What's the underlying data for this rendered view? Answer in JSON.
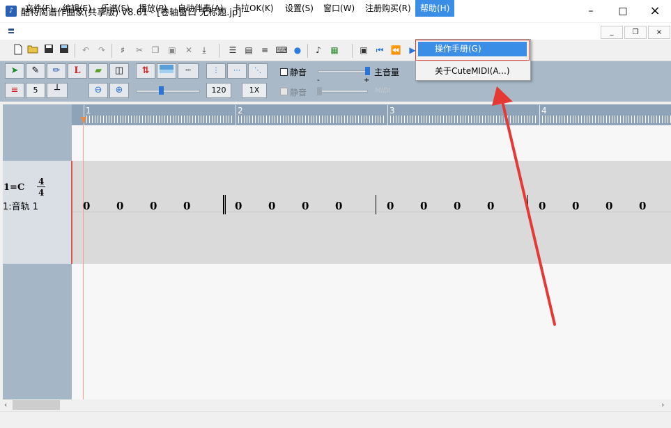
{
  "window": {
    "title": "酷特简谱作曲家(共享版) V8.61 - [卷轴窗口  无标题.jp]",
    "app_icon": "music-note-icon",
    "controls": [
      "minimize-icon",
      "maximize-icon",
      "close-icon"
    ]
  },
  "menu": {
    "items": [
      {
        "label": "文件(F)"
      },
      {
        "label": "编辑(E)"
      },
      {
        "label": "乐谱(S)"
      },
      {
        "label": "播放(P)"
      },
      {
        "label": "自动伴奏(A)"
      },
      {
        "label": "卡拉OK(K)"
      },
      {
        "label": "设置(S)"
      },
      {
        "label": "窗口(W)"
      },
      {
        "label": "注册购买(R)"
      },
      {
        "label": "帮助(H)"
      }
    ],
    "active": "帮助(H)",
    "mdi_controls": [
      "minimize-child-icon",
      "restore-child-icon",
      "close-child-icon"
    ]
  },
  "help_menu": {
    "items": [
      {
        "label": "操作手册(G)",
        "highlighted": true
      },
      {
        "label": "关于CuteMIDI(A...)",
        "highlighted": false
      }
    ]
  },
  "panel": {
    "tempo": "120",
    "speed": "1X",
    "step_value": "5",
    "mute_label": "静音",
    "mute2_label": "静音",
    "main_volume_label": "主音量",
    "midi_label": "MIDI",
    "minus": "-",
    "plus": "+"
  },
  "ruler": {
    "bars": [
      "1",
      "2",
      "3",
      "4"
    ]
  },
  "track": {
    "key": "1=C",
    "time_sig_top": "4",
    "time_sig_bottom": "4",
    "name": "1:音轨 1",
    "measures": [
      [
        "0",
        "0",
        "0",
        "0"
      ],
      [
        "0",
        "0",
        "0",
        "0"
      ],
      [
        "0",
        "0",
        "0",
        "0"
      ],
      [
        "0",
        "0",
        "0",
        "0"
      ]
    ]
  },
  "colors": {
    "menu_active": "#3b8ee6",
    "panel_bg": "#a9b9c7",
    "ruler_bg": "#8fa3b8",
    "annotation_red": "#e53935",
    "cursor": "#f08a40"
  }
}
